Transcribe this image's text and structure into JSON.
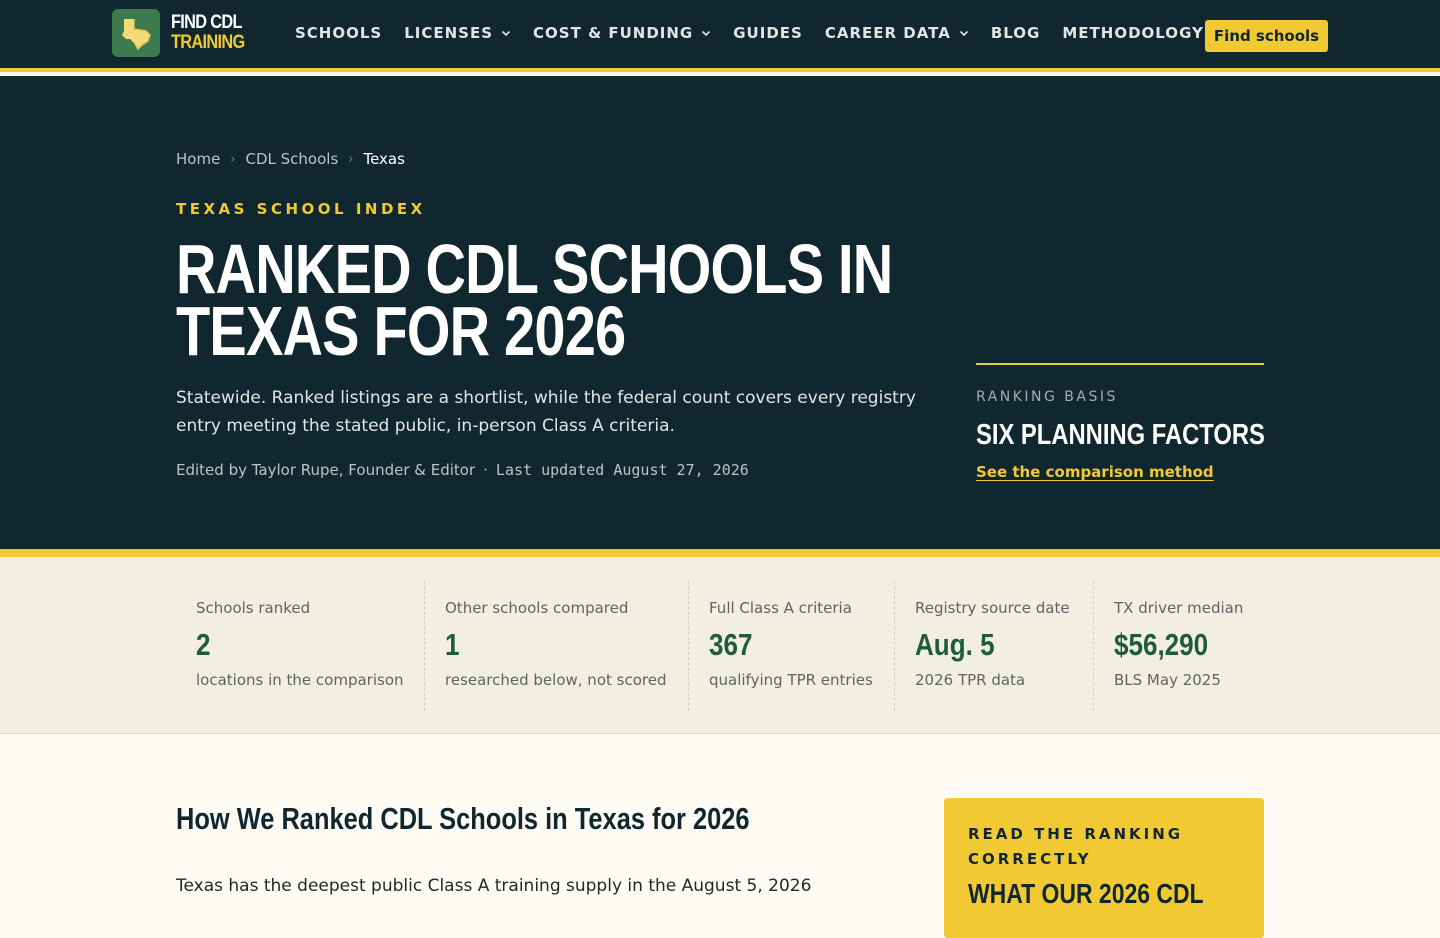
{
  "brand": {
    "line1": "FIND CDL",
    "line2": "TRAINING"
  },
  "nav": {
    "items": [
      {
        "label": "SCHOOLS",
        "dropdown": false
      },
      {
        "label": "LICENSES",
        "dropdown": true
      },
      {
        "label": "COST & FUNDING",
        "dropdown": true
      },
      {
        "label": "GUIDES",
        "dropdown": false
      },
      {
        "label": "CAREER DATA",
        "dropdown": true
      },
      {
        "label": "BLOG",
        "dropdown": false
      },
      {
        "label": "METHODOLOGY",
        "dropdown": false
      }
    ],
    "cta": "Find schools"
  },
  "breadcrumb": [
    "Home",
    "CDL Schools",
    "Texas"
  ],
  "hero": {
    "eyebrow": "TEXAS SCHOOL INDEX",
    "title_line1": "RANKED CDL SCHOOLS IN",
    "title_line2": "TEXAS FOR 2026",
    "lede": "Statewide. Ranked listings are a shortlist, while the federal count covers every registry entry meeting the stated public, in-person Class A criteria.",
    "byline": "Edited by Taylor Rupe, Founder & Editor",
    "separator": "·",
    "updated": "Last updated August 27, 2026"
  },
  "ranking_basis": {
    "label": "RANKING BASIS",
    "title": "SIX PLANNING FACTORS",
    "link": "See the comparison method"
  },
  "stats": [
    {
      "label": "Schools ranked",
      "value": "2",
      "sub": "locations in the comparison"
    },
    {
      "label": "Other schools compared",
      "value": "1",
      "sub": "researched below, not scored"
    },
    {
      "label": "Full Class A criteria",
      "value": "367",
      "sub": "qualifying TPR entries"
    },
    {
      "label": "Registry source date",
      "value": "Aug. 5",
      "sub": "2026 TPR data"
    },
    {
      "label": "TX driver median",
      "value": "$56,290",
      "sub": "BLS May 2025"
    }
  ],
  "section": {
    "title": "How We Ranked CDL Schools in Texas for 2026",
    "text": "Texas has the deepest public Class A training supply in the August 5, 2026"
  },
  "callout": {
    "label": "READ THE RANKING CORRECTLY",
    "title": "WHAT OUR 2026 CDL"
  },
  "colors": {
    "navy": "#10272f",
    "accent_yellow": "#f0c933",
    "stat_green": "#1f5c3c",
    "stats_bg": "#f2eee2",
    "page_bg": "#fdfbf4"
  }
}
